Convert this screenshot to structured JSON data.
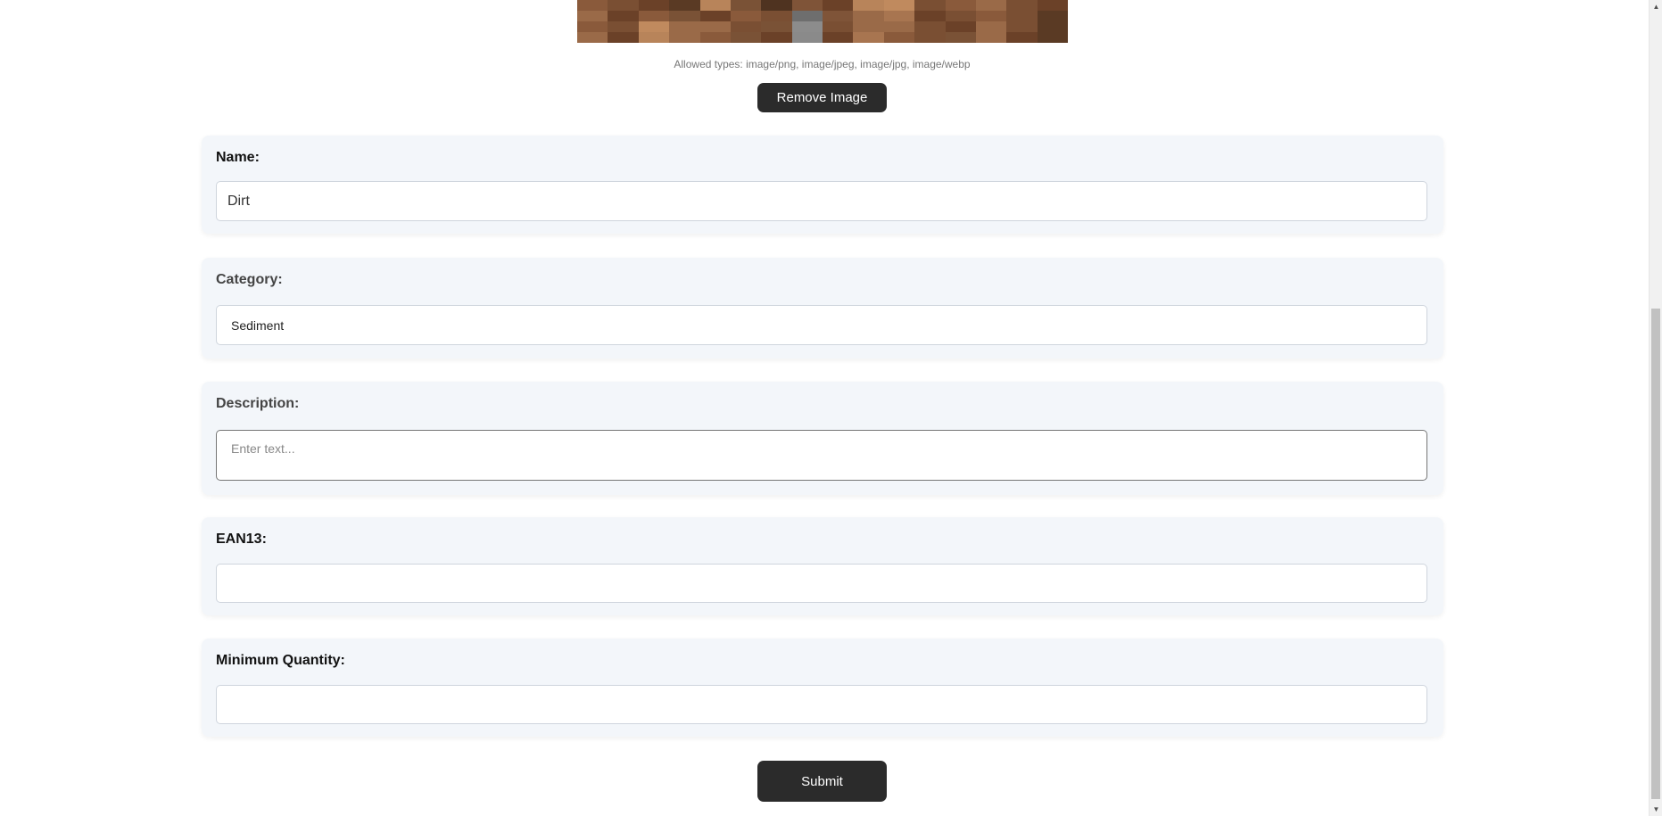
{
  "image_preview": {
    "colors": [
      "#8a5a3b",
      "#7a4f33",
      "#6b4128",
      "#5a3a24",
      "#b8845a",
      "#7a5236",
      "#4f3320",
      "#7f5438",
      "#6b4128",
      "#b8845a",
      "#c08a5e",
      "#7a4f33",
      "#8a5a3b",
      "#9a6a48",
      "#7a4f33",
      "#6b4128",
      "#9a6a48",
      "#6b4128",
      "#8a5a3b",
      "#7a5236",
      "#6b4128",
      "#8a5a3b",
      "#7a4f33",
      "#6e6e6e",
      "#7f5438",
      "#9a6a48",
      "#a87550",
      "#6b4128",
      "#7a4f33",
      "#8a5a3b",
      "#7a4f33",
      "#5a3a24",
      "#8a5a3b",
      "#7a4f33",
      "#c08a5e",
      "#9a6a48",
      "#9a6a48",
      "#7a4f33",
      "#7a5236",
      "#8c8c8c",
      "#7a4f33",
      "#9a6a48",
      "#9a6a48",
      "#7a4f33",
      "#6b4128",
      "#9a6a48",
      "#7a4f33",
      "#5a3a24",
      "#9a6a48",
      "#6b4128",
      "#b8845a",
      "#9a6a48",
      "#8a5a3b",
      "#7a5236",
      "#6b4128",
      "#8a8a8a",
      "#6b4128",
      "#a87550",
      "#8a5a3b",
      "#7a4f33",
      "#7a5236",
      "#9a6a48",
      "#6b4128",
      "#5a3a24"
    ]
  },
  "upload": {
    "allowed_types_text": "Allowed types: image/png, image/jpeg, image/jpg, image/webp",
    "remove_button_label": "Remove Image"
  },
  "fields": {
    "name": {
      "label": "Name:",
      "value": "Dirt"
    },
    "category": {
      "label": "Category:",
      "value": "Sediment"
    },
    "description": {
      "label": "Description:",
      "value": "",
      "placeholder": "Enter text..."
    },
    "ean13": {
      "label": "EAN13:",
      "value": ""
    },
    "minimum_quantity": {
      "label": "Minimum Quantity:",
      "value": ""
    }
  },
  "submit_button_label": "Submit",
  "scrollbar": {
    "up_arrow_icon": "triangle-up-icon",
    "down_arrow_icon": "triangle-down-icon"
  }
}
